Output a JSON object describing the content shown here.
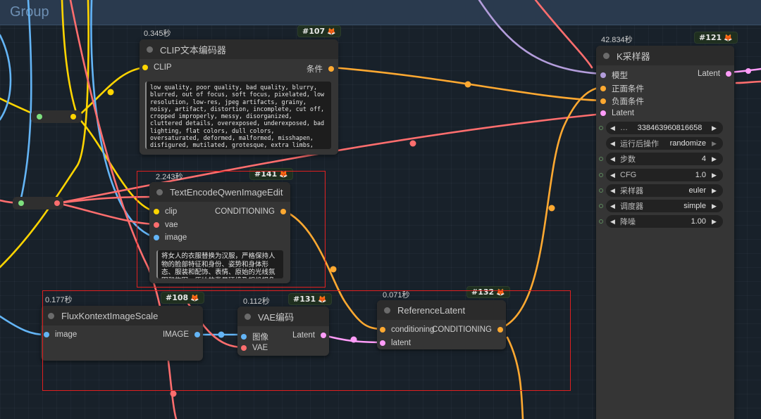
{
  "group": {
    "title": "Group"
  },
  "colors": {
    "clip": "#ffd500",
    "conditioning": "#ffa931",
    "vae": "#ff6e6e",
    "image": "#64b5f6",
    "latent": "#ff9cf9",
    "model": "#b39ddb",
    "widget_dot": "#5c8a5c"
  },
  "nodes": {
    "clip_encode": {
      "timing": "0.345秒",
      "badge": "#107",
      "badge_icon": "fox-icon",
      "title": "CLIP文本编码器",
      "input_clip": "CLIP",
      "output_cond": "条件",
      "prompt": "low quality, poor quality, bad quality, blurry, blurred, out of focus, soft focus, pixelated, low resolution, low-res, jpeg artifacts, grainy, noisy, artifact, distortion, incomplete, cut off, cropped improperly, messy, disorganized, cluttered details, overexposed, underexposed, bad lighting, flat colors, dull colors, oversaturated, deformed, malformed, misshapen, disfigured, mutilated, grotesque, extra limbs, missing limbs, fused limbs,"
    },
    "qwen_edit": {
      "timing": "2.243秒",
      "badge": "#141",
      "title": "TextEncodeQwenImageEdit",
      "input_clip": "clip",
      "input_vae": "vae",
      "input_image": "image",
      "output_cond": "CONDITIONING",
      "prompt": "将女人的衣服替换为汉服，严格保持人物的脸部特征和身份、姿势和身体形态、服装和配饰、表情、原始的光线氛围和构图。原始的背景环境及相机视角"
    },
    "flux_scale": {
      "timing": "0.177秒",
      "badge": "#108",
      "title": "FluxKontextImageScale",
      "input_image": "image",
      "output_image": "IMAGE"
    },
    "vae_encode": {
      "timing": "0.112秒",
      "badge": "#131",
      "title": "VAE编码",
      "input_image": "图像",
      "input_vae": "VAE",
      "output_latent": "Latent"
    },
    "ref_latent": {
      "timing": "0.071秒",
      "badge": "#132",
      "title": "ReferenceLatent",
      "input_cond": "conditioning",
      "input_latent": "latent",
      "output_cond": "CONDITIONING"
    },
    "ksampler": {
      "timing": "42.834秒",
      "badge": "#121",
      "title": "K采样器",
      "input_model": "模型",
      "input_pos": "正面条件",
      "input_neg": "负面条件",
      "input_latent": "Latent",
      "output_latent": "Latent",
      "widgets": [
        {
          "label": "",
          "value": "338463960816658",
          "prefix": "…"
        },
        {
          "label": "运行后操作",
          "value": "randomize"
        },
        {
          "label": "步数",
          "value": "4"
        },
        {
          "label": "CFG",
          "value": "1.0"
        },
        {
          "label": "采样器",
          "value": "euler"
        },
        {
          "label": "调度器",
          "value": "simple"
        },
        {
          "label": "降噪",
          "value": "1.00"
        }
      ]
    }
  }
}
